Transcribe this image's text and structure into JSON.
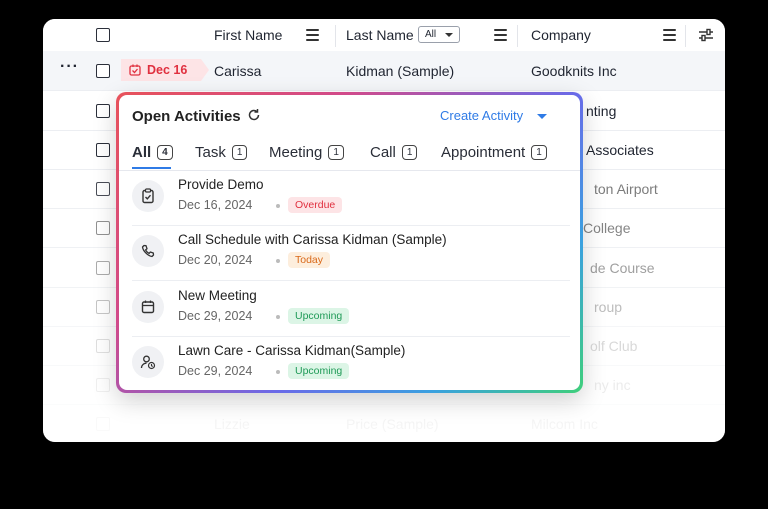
{
  "header": {
    "first_name": "First Name",
    "last_name": "Last Name",
    "last_name_filter": "All",
    "company": "Company"
  },
  "rows": [
    {
      "first": "Carissa",
      "last": "Kidman (Sample)",
      "company": "Goodknits Inc",
      "tag": "Dec 16"
    },
    {
      "first": "",
      "last": "",
      "company": "nting"
    },
    {
      "first": "",
      "last": "",
      "company": "Associates"
    },
    {
      "first": "",
      "last": "",
      "company": "ton Airport"
    },
    {
      "first": "",
      "last": "",
      "company": "College"
    },
    {
      "first": "",
      "last": "",
      "company": "de Course"
    },
    {
      "first": "",
      "last": "",
      "company": "roup"
    },
    {
      "first": "",
      "last": "",
      "company": "olf Club"
    },
    {
      "first": "",
      "last": "",
      "company": "ny  inc"
    },
    {
      "first": "Lizzie",
      "last": "Price (Sample)",
      "company": "Milcom  Inc"
    }
  ],
  "popover": {
    "title": "Open Activities",
    "create_label": "Create Activity",
    "tabs": [
      {
        "label": "All",
        "count": "4"
      },
      {
        "label": "Task",
        "count": "1"
      },
      {
        "label": "Meeting",
        "count": "1"
      },
      {
        "label": "Call",
        "count": "1"
      },
      {
        "label": "Appointment",
        "count": "1"
      }
    ],
    "activities": [
      {
        "icon": "task-icon",
        "title": "Provide Demo",
        "date": "Dec 16, 2024",
        "status": "Overdue",
        "status_color": "#e0303f",
        "status_bg": "#fde4e6"
      },
      {
        "icon": "phone-icon",
        "title": "Call Schedule with Carissa Kidman (Sample)",
        "date": "Dec 20, 2024",
        "status": "Today",
        "status_color": "#d9691a",
        "status_bg": "#fdeedd"
      },
      {
        "icon": "calendar-icon",
        "title": "New Meeting",
        "date": "Dec 29, 2024",
        "status": "Upcoming",
        "status_color": "#1f9a57",
        "status_bg": "#dcf5e6"
      },
      {
        "icon": "appointment-icon",
        "title": "Lawn Care - Carissa Kidman(Sample)",
        "date": "Dec 29, 2024",
        "status": "Upcoming",
        "status_color": "#1f9a57",
        "status_bg": "#dcf5e6"
      }
    ]
  },
  "colors": {
    "accent": "#2f7be6",
    "tag_red": "#e0303f"
  }
}
